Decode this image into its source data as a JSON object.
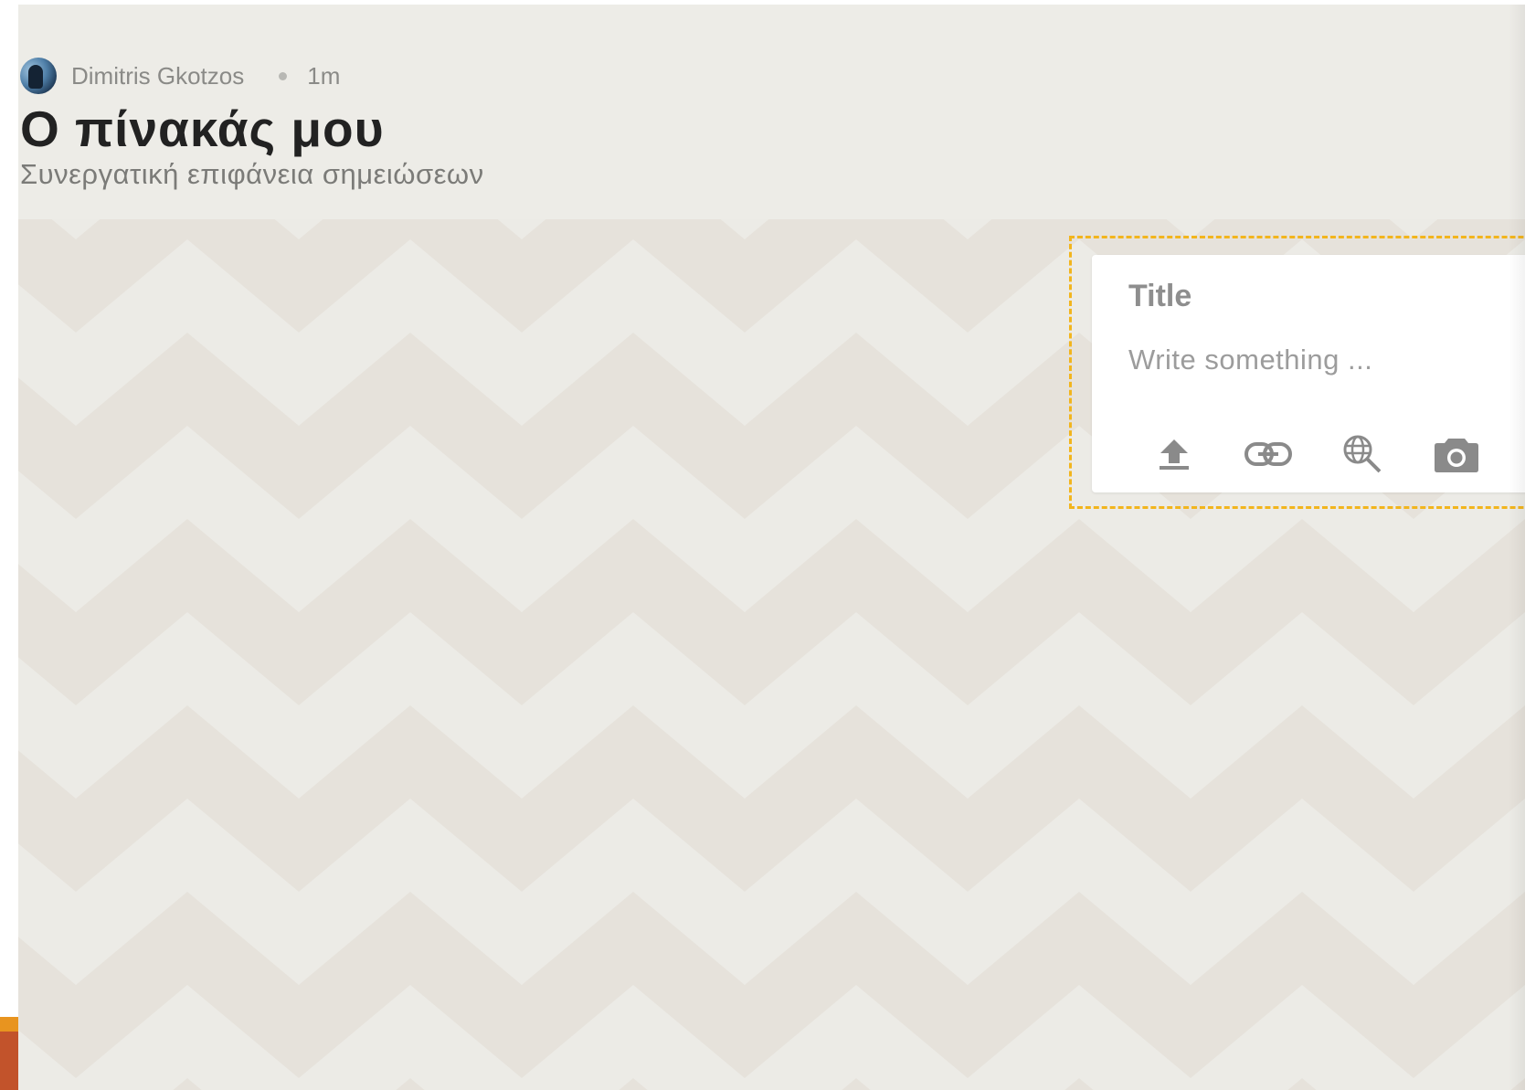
{
  "board": {
    "author": "Dimitris Gkotzos",
    "time_ago": "1m",
    "title": "Ο πίνακάς μου",
    "subtitle": "Συνεργατική επιφάνεια σημειώσεων"
  },
  "post_composer": {
    "title_placeholder": "Title",
    "body_placeholder": "Write something ..."
  },
  "toolbar": {
    "icons": [
      "upload-icon",
      "link-icon",
      "web-search-icon",
      "camera-icon"
    ]
  },
  "colors": {
    "board_background": "#ecebe6",
    "chevron_dark": "#e6e2db",
    "drop_zone_border": "#f2b51d",
    "icon_gray": "#8a8a8a"
  }
}
